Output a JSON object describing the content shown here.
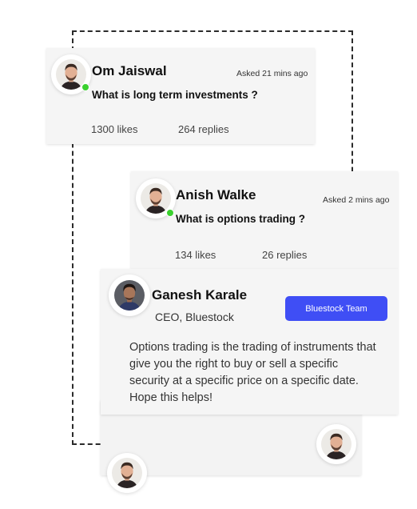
{
  "threads": [
    {
      "author": "Om Jaiswal",
      "asked_time": "Asked 21 mins ago",
      "question": "What is long term investments ?",
      "likes": "1300 likes",
      "replies": "264 replies",
      "online": true
    },
    {
      "author": "Anish Walke",
      "asked_time": "Asked 2 mins ago",
      "question": "What is options trading ?",
      "likes": "134 likes",
      "replies": "26 replies",
      "online": true
    }
  ],
  "answer": {
    "author": "Ganesh Karale",
    "role": "CEO, Bluestock",
    "badge": "Bluestock Team",
    "text": "Options trading is the trading of instruments that give you the right to buy or sell a specific security at a specific price on a specific date. Hope this helps!"
  },
  "colors": {
    "accent": "#3f4ef5",
    "online": "#3bd12f",
    "card_bg": "#f5f5f5"
  },
  "icons": [
    "avatar-photo",
    "online-status-dot"
  ]
}
